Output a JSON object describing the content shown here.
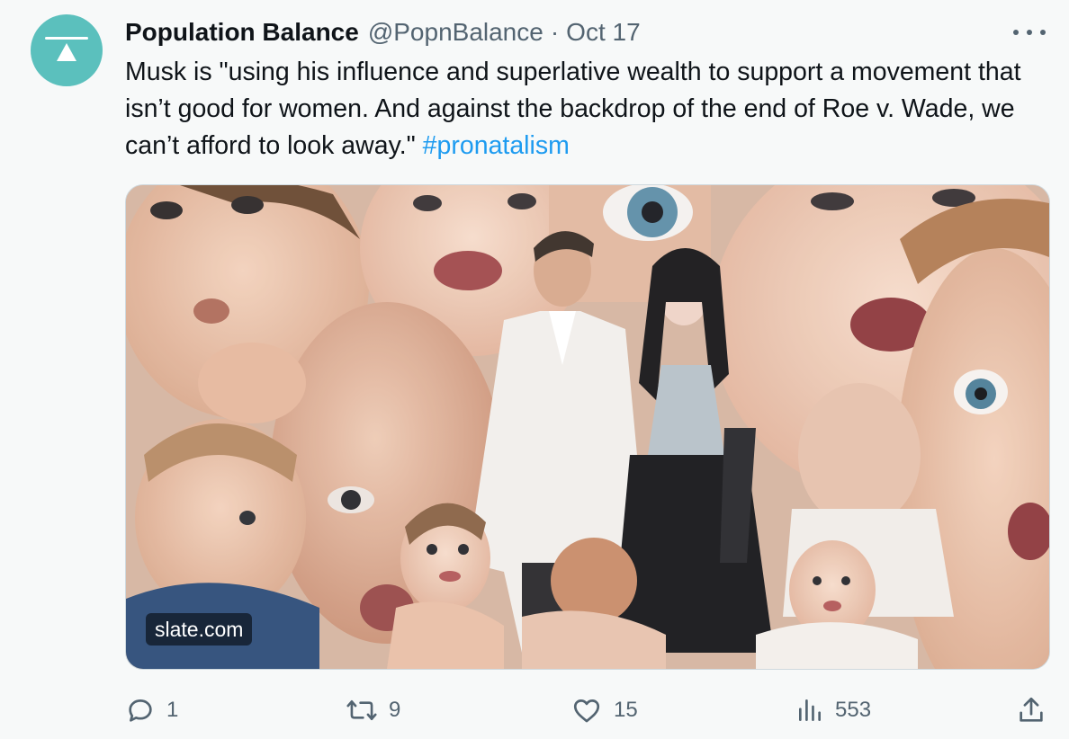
{
  "tweet": {
    "author": {
      "display_name": "Population Balance",
      "handle": "@PopnBalance",
      "avatar_icon": "population-balance-logo",
      "avatar_color": "#5bc0bd"
    },
    "separator": "·",
    "date": "Oct 17",
    "text_main": "Musk is \"using his influence and superlative wealth to support a movement that isn’t good for women. And against the backdrop of the end of Roe v. Wade, we can’t afford to look away.\" ",
    "hashtag": "#pronatalism",
    "media": {
      "source": "slate.com"
    },
    "actions": {
      "reply": {
        "icon": "reply-icon",
        "count": "1"
      },
      "retweet": {
        "icon": "retweet-icon",
        "count": "9"
      },
      "like": {
        "icon": "heart-icon",
        "count": "15"
      },
      "views": {
        "icon": "views-icon",
        "count": "553"
      },
      "share": {
        "icon": "share-icon"
      }
    }
  },
  "colors": {
    "text": "#0f1419",
    "secondary": "#536471",
    "link": "#1d9bf0",
    "background": "#f7f9f9"
  }
}
